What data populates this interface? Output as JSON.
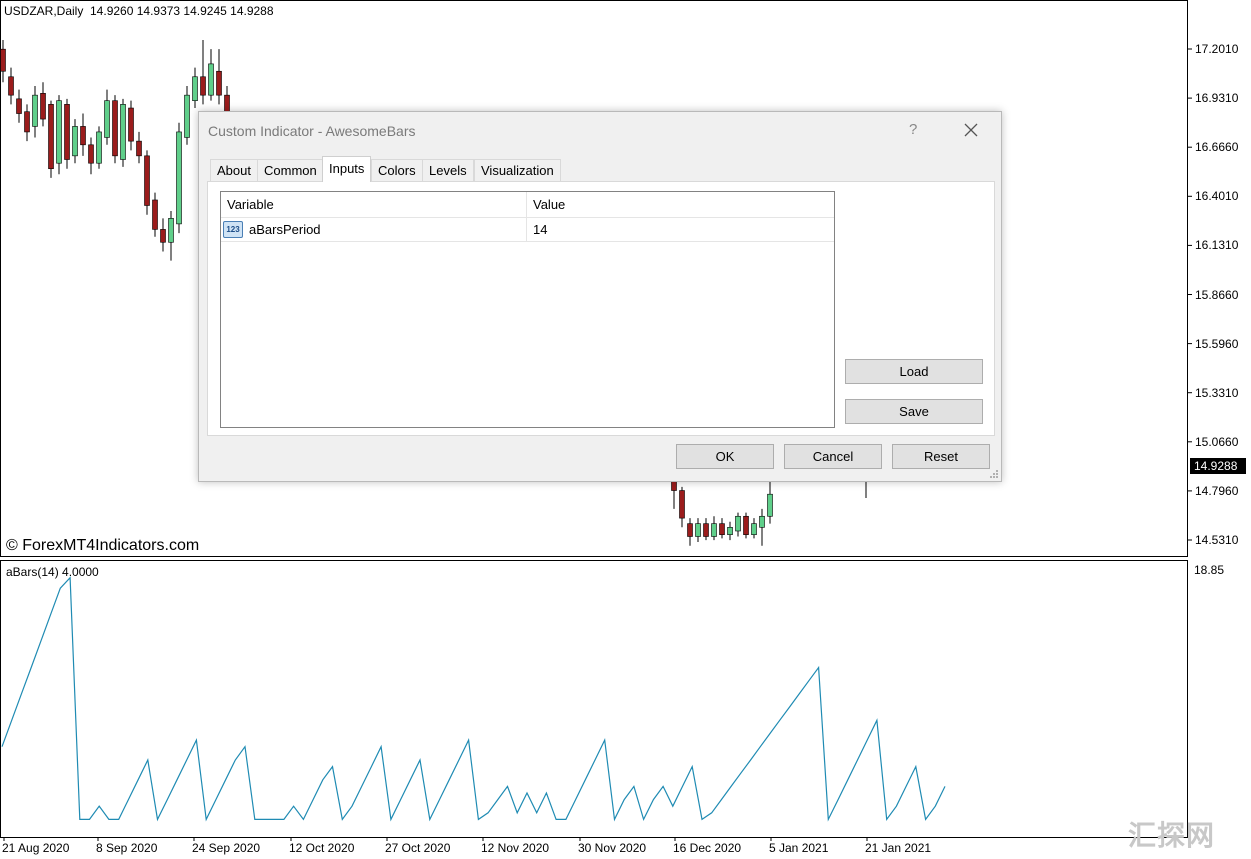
{
  "chart": {
    "symbol_info": "USDZAR,Daily  14.9260 14.9373 14.9245 14.9288",
    "watermark": "© ForexMT4Indicators.com",
    "current_price": "14.9288",
    "price_ticks": [
      "17.2010",
      "16.9310",
      "16.6660",
      "16.4010",
      "16.1310",
      "15.8660",
      "15.5960",
      "15.3310",
      "15.0660",
      "14.7960",
      "14.5310"
    ],
    "indicator_label": "aBars(14) 4.0000",
    "indicator_max": "18.85",
    "date_ticks": [
      "21 Aug 2020",
      "8 Sep 2020",
      "24 Sep 2020",
      "12 Oct 2020",
      "27 Oct 2020",
      "12 Nov 2020",
      "30 Nov 2020",
      "16 Dec 2020",
      "5 Jan 2021",
      "21 Jan 2021"
    ],
    "colors": {
      "bull": "#5fcf8a",
      "bear": "#9b1c1c",
      "line": "#1f8bb3"
    },
    "brand_watermark": "汇探网"
  },
  "chart_data": [
    {
      "type": "candlestick",
      "title": "USDZAR,Daily",
      "ylim": [
        14.45,
        17.35
      ],
      "candles_visible_left": [
        {
          "o": 17.2,
          "c": 17.08,
          "h": 17.25,
          "l": 17.02
        },
        {
          "o": 17.05,
          "c": 16.95,
          "h": 17.1,
          "l": 16.9
        },
        {
          "o": 16.93,
          "c": 16.85,
          "h": 16.98,
          "l": 16.8
        },
        {
          "o": 16.86,
          "c": 16.75,
          "h": 16.9,
          "l": 16.7
        },
        {
          "o": 16.78,
          "c": 16.95,
          "h": 17.0,
          "l": 16.72
        },
        {
          "o": 16.96,
          "c": 16.82,
          "h": 17.02,
          "l": 16.78
        },
        {
          "o": 16.9,
          "c": 16.55,
          "h": 16.92,
          "l": 16.5
        },
        {
          "o": 16.58,
          "c": 16.92,
          "h": 16.95,
          "l": 16.52
        },
        {
          "o": 16.9,
          "c": 16.6,
          "h": 16.93,
          "l": 16.55
        },
        {
          "o": 16.62,
          "c": 16.78,
          "h": 16.82,
          "l": 16.58
        },
        {
          "o": 16.78,
          "c": 16.68,
          "h": 16.85,
          "l": 16.62
        },
        {
          "o": 16.68,
          "c": 16.58,
          "h": 16.72,
          "l": 16.52
        },
        {
          "o": 16.58,
          "c": 16.75,
          "h": 16.78,
          "l": 16.55
        },
        {
          "o": 16.72,
          "c": 16.92,
          "h": 16.98,
          "l": 16.68
        },
        {
          "o": 16.92,
          "c": 16.62,
          "h": 16.95,
          "l": 16.58
        },
        {
          "o": 16.6,
          "c": 16.9,
          "h": 16.93,
          "l": 16.56
        },
        {
          "o": 16.88,
          "c": 16.7,
          "h": 16.92,
          "l": 16.65
        },
        {
          "o": 16.7,
          "c": 16.62,
          "h": 16.75,
          "l": 16.58
        },
        {
          "o": 16.62,
          "c": 16.35,
          "h": 16.65,
          "l": 16.3
        },
        {
          "o": 16.38,
          "c": 16.22,
          "h": 16.42,
          "l": 16.18
        },
        {
          "o": 16.22,
          "c": 16.15,
          "h": 16.28,
          "l": 16.1
        },
        {
          "o": 16.15,
          "c": 16.28,
          "h": 16.32,
          "l": 16.05
        },
        {
          "o": 16.25,
          "c": 16.75,
          "h": 16.8,
          "l": 16.2
        },
        {
          "o": 16.72,
          "c": 16.95,
          "h": 17.0,
          "l": 16.68
        },
        {
          "o": 16.92,
          "c": 17.05,
          "h": 17.1,
          "l": 16.88
        },
        {
          "o": 17.05,
          "c": 16.95,
          "h": 17.25,
          "l": 16.9
        },
        {
          "o": 16.95,
          "c": 17.12,
          "h": 17.2,
          "l": 16.92
        },
        {
          "o": 17.08,
          "c": 16.95,
          "h": 17.2,
          "l": 16.9
        },
        {
          "o": 16.95,
          "c": 16.85,
          "h": 17.0,
          "l": 16.8
        }
      ],
      "candles_visible_right": [
        {
          "o": 14.85,
          "c": 14.8,
          "h": 14.88,
          "l": 14.7
        },
        {
          "o": 14.8,
          "c": 14.65,
          "h": 14.82,
          "l": 14.6
        },
        {
          "o": 14.62,
          "c": 14.55,
          "h": 14.65,
          "l": 14.5
        },
        {
          "o": 14.55,
          "c": 14.62,
          "h": 14.65,
          "l": 14.52
        },
        {
          "o": 14.62,
          "c": 14.55,
          "h": 14.65,
          "l": 14.53
        },
        {
          "o": 14.55,
          "c": 14.62,
          "h": 14.66,
          "l": 14.53
        },
        {
          "o": 14.62,
          "c": 14.56,
          "h": 14.65,
          "l": 14.54
        },
        {
          "o": 14.56,
          "c": 14.6,
          "h": 14.63,
          "l": 14.53
        },
        {
          "o": 14.58,
          "c": 14.66,
          "h": 14.68,
          "l": 14.55
        },
        {
          "o": 14.66,
          "c": 14.56,
          "h": 14.68,
          "l": 14.54
        },
        {
          "o": 14.56,
          "c": 14.62,
          "h": 14.65,
          "l": 14.54
        },
        {
          "o": 14.6,
          "c": 14.66,
          "h": 14.7,
          "l": 14.5
        },
        {
          "o": 14.66,
          "c": 14.78,
          "h": 14.85,
          "l": 14.62
        }
      ]
    },
    {
      "type": "line",
      "title": "aBars(14) 4.0000",
      "ylim": [
        0,
        18.85
      ],
      "values": [
        6,
        8,
        10,
        12,
        14,
        16,
        18,
        18.8,
        0.5,
        0.5,
        1.5,
        0.5,
        0.5,
        2,
        3.5,
        5,
        0.5,
        2,
        3.5,
        5,
        6.5,
        0.5,
        2,
        3.5,
        5,
        6,
        0.5,
        0.5,
        0.5,
        0.5,
        1.5,
        0.5,
        2,
        3.5,
        4.5,
        0.5,
        1.5,
        3,
        4.5,
        6,
        0.5,
        2,
        3.5,
        5,
        0.5,
        2,
        3.5,
        5,
        6.5,
        0.5,
        1,
        2,
        3,
        1,
        2.5,
        1,
        2.5,
        0.5,
        0.5,
        2,
        3.5,
        5,
        6.5,
        0.5,
        2,
        3,
        0.5,
        2,
        3,
        1.5,
        3,
        4.5,
        0.5,
        1,
        2,
        3,
        4,
        5,
        6,
        7,
        8,
        9,
        10,
        11,
        12,
        0.5,
        2,
        3.5,
        5,
        6.5,
        8,
        0.5,
        1.5,
        3,
        4.5,
        0.5,
        1.5,
        3
      ]
    }
  ],
  "dialog": {
    "title": "Custom Indicator - AwesomeBars",
    "help": "?",
    "tabs": [
      "About",
      "Common",
      "Inputs",
      "Colors",
      "Levels",
      "Visualization"
    ],
    "active_tab": "Inputs",
    "grid": {
      "headers": [
        "Variable",
        "Value"
      ],
      "rows": [
        {
          "icon": "123",
          "variable": "aBarsPeriod",
          "value": "14"
        }
      ]
    },
    "buttons": {
      "load": "Load",
      "save": "Save",
      "ok": "OK",
      "cancel": "Cancel",
      "reset": "Reset"
    }
  }
}
